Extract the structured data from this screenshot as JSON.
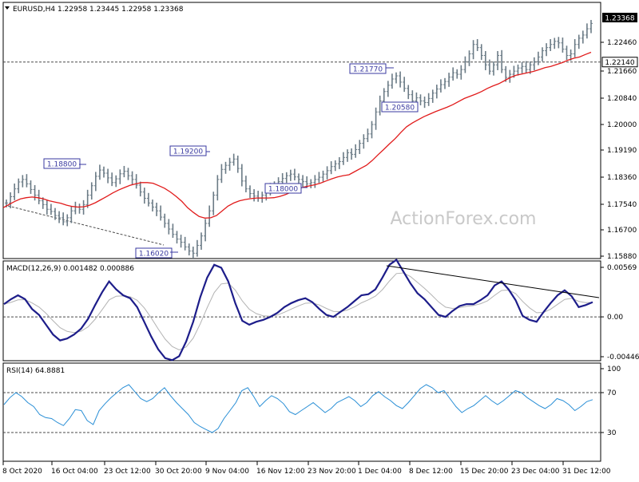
{
  "colors": {
    "background": "#ffffff",
    "frame": "#000000",
    "price_bars": "#6b7b86",
    "moving_average": "#e11b1b",
    "macd_line": "#1d1d8a",
    "signal_line": "#b3b3b3",
    "rsi_line": "#2a8fd6",
    "reference_line": "#4a4a4a",
    "annotation_border": "#3a3aa0",
    "watermark": "#c9c9c9",
    "current_price_box": "#000000",
    "current_price_text": "#ffffff"
  },
  "chart_data": [
    {
      "type": "line",
      "title": "EURUSD,H4  1.22958 1.23445 1.22958 1.23368",
      "watermark": "ActionForex.com",
      "ylim": [
        1.1588,
        1.2404
      ],
      "y_ticks": [
        "1.23368",
        "1.22460",
        "1.21660",
        "1.20840",
        "1.20000",
        "1.19190",
        "1.18360",
        "1.17540",
        "1.16700",
        "1.15880"
      ],
      "x_ticks": [
        "8 Oct 2020",
        "16 Oct 04:00",
        "23 Oct 12:00",
        "30 Oct 20:00",
        "9 Nov 04:00",
        "16 Nov 12:00",
        "23 Nov 20:00",
        "1 Dec 04:00",
        "8 Dec 12:00",
        "15 Dec 20:00",
        "23 Dec 04:00",
        "31 Dec 12:00"
      ],
      "current_price": "1.23368",
      "horizontal_level": "1.22140",
      "annotations": [
        "1.18800",
        "1.19200",
        "1.16020",
        "1.18000",
        "1.21770",
        "1.20580"
      ],
      "series": [
        {
          "values": [
            1.1765,
            1.1785,
            1.181,
            1.1832,
            1.184,
            1.1826,
            1.1808,
            1.179,
            1.1772,
            1.176,
            1.1745,
            1.1738,
            1.1725,
            1.1718,
            1.1705,
            1.1718,
            1.174,
            1.1752,
            1.1745,
            1.176,
            1.179,
            1.182,
            1.185,
            1.187,
            1.186,
            1.1845,
            1.183,
            1.1842,
            1.1858,
            1.1866,
            1.1852,
            1.184,
            1.1822,
            1.18,
            1.178,
            1.1765,
            1.1752,
            1.174,
            1.172,
            1.17,
            1.1682,
            1.1665,
            1.165,
            1.164,
            1.1625,
            1.1612,
            1.1605,
            1.163,
            1.166,
            1.17,
            1.174,
            1.179,
            1.184,
            1.1872,
            1.1885,
            1.1895,
            1.1905,
            1.1875,
            1.1835,
            1.181,
            1.1795,
            1.1787,
            1.178,
            1.179,
            1.18,
            1.1812,
            1.1823,
            1.1833,
            1.1843,
            1.1852,
            1.1857,
            1.1848,
            1.184,
            1.1833,
            1.1826,
            1.183,
            1.184,
            1.1847,
            1.1857,
            1.1868,
            1.1881,
            1.189,
            1.1897,
            1.191,
            1.1925,
            1.192,
            1.1935,
            1.1955,
            1.197,
            1.1985,
            1.2015,
            1.2055,
            1.209,
            1.212,
            1.214,
            1.216,
            1.217,
            1.215,
            1.213,
            1.211,
            1.209,
            1.21,
            1.209,
            1.2085,
            1.2098,
            1.2115,
            1.2128,
            1.2142,
            1.2152,
            1.2166,
            1.218,
            1.2175,
            1.219,
            1.2215,
            1.224,
            1.227,
            1.226,
            1.2235,
            1.2205,
            1.2185,
            1.2205,
            1.2235,
            1.219,
            1.2165,
            1.2175,
            1.2185,
            1.2195,
            1.22,
            1.219,
            1.2205,
            1.2215,
            1.223,
            1.225,
            1.226,
            1.227,
            1.228,
            1.2275,
            1.2255,
            1.2235,
            1.224,
            1.227,
            1.229,
            1.23,
            1.232,
            1.2337
          ]
        },
        {
          "values": [
            1.175,
            1.176,
            1.177,
            1.1778,
            1.1782,
            1.1784,
            1.1782,
            1.1778,
            1.1772,
            1.1768,
            1.1764,
            1.1758,
            1.1754,
            1.1752,
            1.1753,
            1.1758,
            1.1766,
            1.1776,
            1.1786,
            1.1797,
            1.1806,
            1.1814,
            1.1821,
            1.1826,
            1.183,
            1.183,
            1.1828,
            1.182,
            1.1812,
            1.18,
            1.1786,
            1.177,
            1.175,
            1.1735,
            1.1722,
            1.1717,
            1.1718,
            1.1725,
            1.174,
            1.1755,
            1.1765,
            1.1772,
            1.1776,
            1.1779,
            1.1781,
            1.1781,
            1.1781,
            1.1782,
            1.1786,
            1.1792,
            1.18,
            1.1808,
            1.1815,
            1.1819,
            1.1823,
            1.1828,
            1.1835,
            1.1842,
            1.1848,
            1.1852,
            1.1855,
            1.1865,
            1.1875,
            1.1885,
            1.19,
            1.1918,
            1.1935,
            1.1953,
            1.197,
            1.199,
            1.2008,
            1.202,
            1.203,
            1.204,
            1.2048,
            1.2056,
            1.2063,
            1.207,
            1.2078,
            1.2088,
            1.2098,
            1.2105,
            1.2112,
            1.212,
            1.213,
            1.2138,
            1.2145,
            1.2155,
            1.2165,
            1.2172,
            1.2176,
            1.218,
            1.2184,
            1.219,
            1.2196,
            1.22,
            1.2206,
            1.2212,
            1.222,
            1.2226,
            1.223,
            1.2238,
            1.2245
          ]
        }
      ]
    },
    {
      "type": "line",
      "title": "MACD(12,26,9) 0.001482 0.000886",
      "ylim": [
        -0.00446,
        0.00569
      ],
      "y_ticks": [
        "0.00569",
        "0.00",
        "-0.00446"
      ],
      "series": [
        {
          "values": [
            0.0013,
            0.0018,
            0.0022,
            0.0018,
            0.0008,
            0.0002,
            -0.0008,
            -0.0018,
            -0.0024,
            -0.0022,
            -0.0018,
            -0.0012,
            -0.0002,
            0.0012,
            0.0025,
            0.0036,
            0.0028,
            0.0022,
            0.0019,
            0.001,
            -0.0005,
            -0.002,
            -0.0033,
            -0.0042,
            -0.0044,
            -0.004,
            -0.0025,
            -0.0005,
            0.002,
            0.004,
            0.0053,
            0.005,
            0.0036,
            0.0014,
            -0.0004,
            -0.0008,
            -0.0005,
            -0.0003,
            0.0,
            0.0004,
            0.001,
            0.0014,
            0.0017,
            0.0019,
            0.0015,
            0.0008,
            0.0002,
            0.0,
            0.0005,
            0.001,
            0.0016,
            0.0022,
            0.0023,
            0.0028,
            0.004,
            0.0053,
            0.0058,
            0.0046,
            0.0034,
            0.0024,
            0.0018,
            0.001,
            0.0002,
            0.0,
            0.0006,
            0.0011,
            0.0013,
            0.0013,
            0.0017,
            0.0022,
            0.0032,
            0.0036,
            0.0028,
            0.0017,
            0.0001,
            -0.0003,
            -0.0005,
            0.0005,
            0.0014,
            0.0022,
            0.0027,
            0.0021,
            0.001,
            0.0012,
            0.0015
          ]
        }
      ]
    },
    {
      "type": "line",
      "title": "RSI(14) 64.8881",
      "ylim": [
        0,
        100
      ],
      "y_ticks": [
        "100",
        "70",
        "30",
        "0"
      ],
      "series": [
        {
          "values": [
            58,
            65,
            70,
            66,
            60,
            56,
            48,
            45,
            44,
            40,
            37,
            44,
            53,
            52,
            42,
            38,
            52,
            59,
            65,
            70,
            75,
            78,
            71,
            64,
            61,
            64,
            70,
            75,
            67,
            60,
            54,
            48,
            40,
            36,
            33,
            30,
            34,
            44,
            52,
            60,
            72,
            75,
            66,
            56,
            62,
            67,
            64,
            59,
            51,
            48,
            52,
            56,
            60,
            55,
            50,
            54,
            60,
            63,
            66,
            62,
            56,
            60,
            67,
            71,
            66,
            62,
            57,
            54,
            60,
            67,
            74,
            78,
            75,
            70,
            72,
            64,
            56,
            50,
            54,
            57,
            62,
            67,
            62,
            58,
            62,
            67,
            72,
            70,
            65,
            61,
            57,
            54,
            58,
            64,
            62,
            58,
            52,
            56,
            61,
            63
          ]
        }
      ]
    }
  ]
}
